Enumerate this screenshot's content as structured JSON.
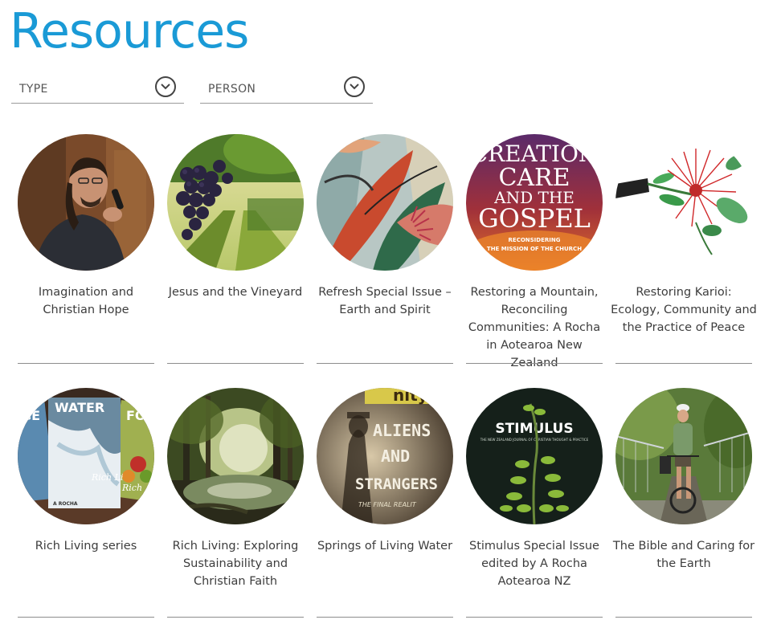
{
  "page": {
    "title": "Resources",
    "title_color": "#1a9ad6"
  },
  "filters": [
    {
      "label": "TYPE",
      "icon": "chevron-down-icon"
    },
    {
      "label": "PERSON",
      "icon": "chevron-down-icon"
    }
  ],
  "cards": [
    {
      "title": "Imagination and Christian Hope",
      "image": "speaker-with-microphone"
    },
    {
      "title": "Jesus and the Vineyard",
      "image": "grapes-vineyard"
    },
    {
      "title": "Refresh Special Issue – Earth and Spirit",
      "image": "gum-leaves-painting"
    },
    {
      "title": "Restoring a Mountain, Reconciling Communities: A Rocha in Aotearoa New Zealand",
      "image": "creation-care-book-cover",
      "cover_text": {
        "line1": "CREATION",
        "line2": "CARE",
        "line3": "AND THE",
        "line4": "GOSPEL",
        "sub1": "RECONSIDERING",
        "sub2": "THE MISSION OF THE CHURCH"
      }
    },
    {
      "title": "Restoring Karioi: Ecology, Community and the Practice of Peace",
      "image": "pohutukawa-flower-illustration"
    },
    {
      "title": "Rich Living series",
      "image": "water-booklets",
      "cover_text": {
        "main": "WATER",
        "left": "GE",
        "right": "FO",
        "inner": "Rich Li",
        "inner2": "Rich",
        "brand": "A ROCHA"
      }
    },
    {
      "title": "Rich Living: Exploring Sustainability and Christian Faith",
      "image": "forest-river"
    },
    {
      "title": "Springs of Living Water",
      "image": "aliens-and-strangers-cover",
      "cover_text": {
        "top": "nity",
        "line1": "ALIENS",
        "line2": "AND",
        "line3": "STRANGERS",
        "sub": "THE FINAL REALIT"
      }
    },
    {
      "title": "Stimulus Special Issue edited by A Rocha Aotearoa NZ",
      "image": "stimulus-cover",
      "cover_text": {
        "title": "STIMULUS",
        "sub": "THE NEW ZEALAND JOURNAL OF CHRISTIAN THOUGHT & PRACTICE"
      }
    },
    {
      "title": "The Bible and Caring for the Earth",
      "image": "cyclist-on-bridge"
    }
  ]
}
